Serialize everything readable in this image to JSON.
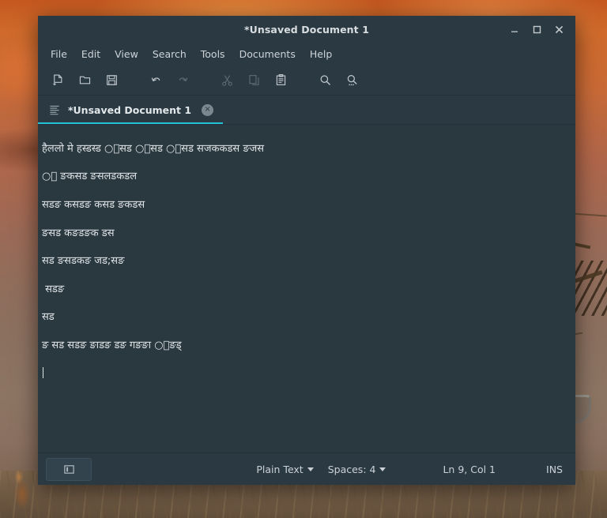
{
  "window": {
    "title": "*Unsaved Document 1",
    "controls": [
      {
        "name": "minimize",
        "glyph": "minimize-icon"
      },
      {
        "name": "maximize",
        "glyph": "maximize-icon"
      },
      {
        "name": "close",
        "glyph": "close-icon"
      }
    ]
  },
  "menubar": {
    "items": [
      {
        "label": "File"
      },
      {
        "label": "Edit"
      },
      {
        "label": "View"
      },
      {
        "label": "Search"
      },
      {
        "label": "Tools"
      },
      {
        "label": "Documents"
      },
      {
        "label": "Help"
      }
    ]
  },
  "toolbar": {
    "buttons": [
      {
        "icon": "new-document-icon",
        "enabled": true
      },
      {
        "icon": "open-folder-icon",
        "enabled": true
      },
      {
        "icon": "save-icon",
        "enabled": true
      },
      {
        "icon": "undo-icon",
        "enabled": true
      },
      {
        "icon": "redo-icon",
        "enabled": false
      },
      {
        "icon": "cut-icon",
        "enabled": false
      },
      {
        "icon": "copy-icon",
        "enabled": false
      },
      {
        "icon": "paste-icon",
        "enabled": true
      },
      {
        "icon": "find-icon",
        "enabled": true
      },
      {
        "icon": "find-replace-icon",
        "enabled": true
      }
    ]
  },
  "tabs": [
    {
      "title": "*Unsaved Document 1",
      "active": true,
      "icon": "document-lines-icon",
      "close_glyph": "×"
    }
  ],
  "editor": {
    "lines": [
      "हैललो मे हस्डस्ड ○्सड ○्सड ○्सड सजककडस ङजस",
      "○् ङकसड ङसलडकडल",
      "सडङ कसडङ कसड ङकडस",
      "ङसड कङडङक डस",
      "सड ङसडकङ जड;सङ",
      " सडङ",
      "सड",
      "ङ सड सडङ ङाडङ डङ गङङा ○्ङड्",
      ""
    ],
    "cursor_line_index": 8
  },
  "statusbar": {
    "panel_toggle_icon": "side-panel-icon",
    "language": "Plain Text",
    "indentation": "Spaces: 4",
    "position": "Ln 9, Col 1",
    "insert_mode": "INS"
  },
  "colors": {
    "window_bg": "#2b3943",
    "editor_bg": "#2a3840",
    "accent": "#22c3d6",
    "text": "#dfe4e7",
    "muted": "#9aa7ae"
  }
}
